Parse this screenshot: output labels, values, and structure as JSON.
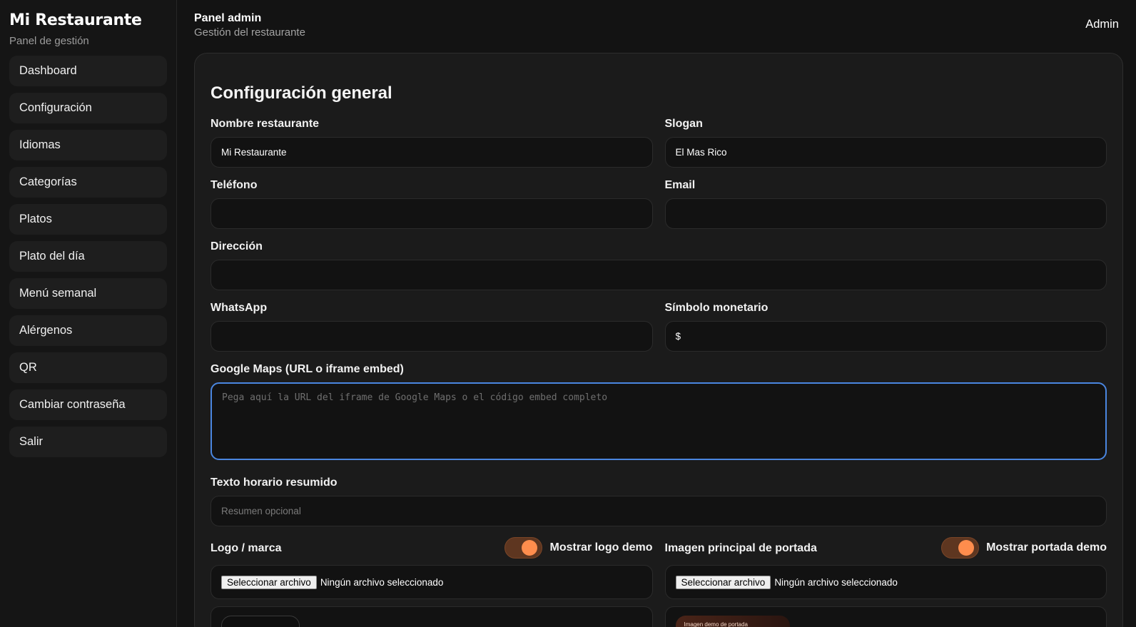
{
  "sidebar": {
    "brand": "Mi Restaurante",
    "subtitle": "Panel de gestión",
    "items": [
      {
        "label": "Dashboard"
      },
      {
        "label": "Configuración"
      },
      {
        "label": "Idiomas"
      },
      {
        "label": "Categorías"
      },
      {
        "label": "Platos"
      },
      {
        "label": "Plato del día"
      },
      {
        "label": "Menú semanal"
      },
      {
        "label": "Alérgenos"
      },
      {
        "label": "QR"
      },
      {
        "label": "Cambiar contraseña"
      },
      {
        "label": "Salir"
      }
    ]
  },
  "header": {
    "title": "Panel admin",
    "subtitle": "Gestión del restaurante",
    "user": "Admin"
  },
  "form": {
    "title": "Configuración general",
    "nombre": {
      "label": "Nombre restaurante",
      "value": "Mi Restaurante"
    },
    "slogan": {
      "label": "Slogan",
      "value": "El Mas Rico"
    },
    "telefono": {
      "label": "Teléfono",
      "value": ""
    },
    "email": {
      "label": "Email",
      "value": ""
    },
    "direccion": {
      "label": "Dirección",
      "value": ""
    },
    "whatsapp": {
      "label": "WhatsApp",
      "value": ""
    },
    "simbolo": {
      "label": "Símbolo monetario",
      "value": "$"
    },
    "maps": {
      "label": "Google Maps (URL o iframe embed)",
      "placeholder": "Pega aquí la URL del iframe de Google Maps o el código embed completo"
    },
    "horario": {
      "label": "Texto horario resumido",
      "placeholder": "Resumen opcional"
    },
    "logo": {
      "label": "Logo / marca",
      "toggle_label": "Mostrar logo demo",
      "toggle_on": true,
      "file_button": "Seleccionar archivo",
      "file_status": "Ningún archivo seleccionado"
    },
    "portada": {
      "label": "Imagen principal de portada",
      "toggle_label": "Mostrar portada demo",
      "toggle_on": true,
      "file_button": "Seleccionar archivo",
      "file_status": "Ningún archivo seleccionado",
      "preview_text": "Imagen demo de portada"
    }
  },
  "colors": {
    "accent": "#ff8d4d",
    "focus": "#4a86e0",
    "background": "#131313"
  }
}
